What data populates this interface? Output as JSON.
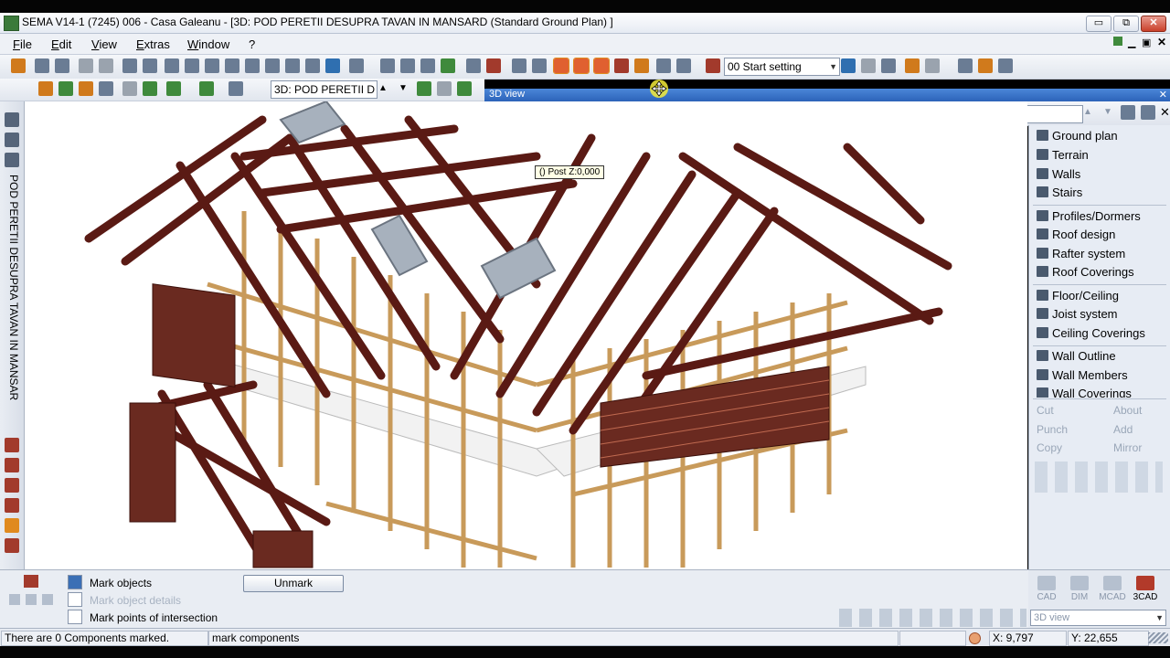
{
  "window": {
    "title": "SEMA V14-1 (7245) 006 - Casa Galeanu - [3D: POD PERETII DESUPRA TAVAN IN MANSARD (Standard Ground Plan) ]",
    "minimize": "▭",
    "restore": "⧉",
    "close": "✕"
  },
  "menu": [
    "File",
    "Edit",
    "View",
    "Extras",
    "Window",
    "?"
  ],
  "toolbar": {
    "start_setting": "00 Start setting",
    "view_combo": "3D: POD PERETII D"
  },
  "view3d": {
    "title": "3D view",
    "search_value": "---"
  },
  "tooltip": "()  Post Z:0,000",
  "left_vertical_label": "POD PERETII DESUPRA TAVAN IN MANSAR",
  "right_panel": {
    "items": [
      "Ground plan",
      "Terrain",
      "Walls",
      "Stairs",
      "Profiles/Dormers",
      "Roof design",
      "Rafter system",
      "Roof Coverings",
      "Floor/Ceiling",
      "Joist system",
      "Ceiling Coverings",
      "Wall Outline",
      "Wall Members",
      "Wall Coverings"
    ],
    "actions": [
      "Cut",
      "About",
      "Punch",
      "Add",
      "Copy",
      "Mirror"
    ]
  },
  "bottom": {
    "mark_objects": "Mark objects",
    "mark_object_details": "Mark object details",
    "mark_points": "Mark points of intersection",
    "unmark": "Unmark"
  },
  "modes": [
    "CAD",
    "DIM",
    "MCAD",
    "3CAD"
  ],
  "mode_combo": "3D view",
  "status": {
    "left": "There are 0 Components marked.",
    "mid": "mark components",
    "x": "X: 9,797",
    "y": "Y: 22,655"
  }
}
